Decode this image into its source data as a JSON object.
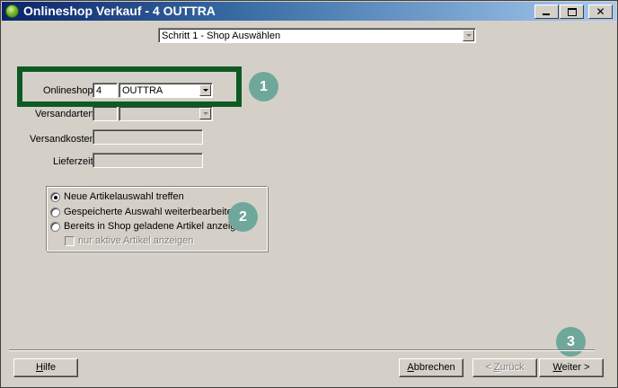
{
  "window": {
    "title": "Onlineshop Verkauf - 4 OUTTRA",
    "controls": {
      "minimize": "_",
      "maximize": "□",
      "close": "✕"
    }
  },
  "step_selector": {
    "value": "Schritt 1 - Shop Auswählen"
  },
  "form": {
    "onlineshop": {
      "label": "Onlineshop",
      "number": "4",
      "name": "OUTTRA"
    },
    "versandarten": {
      "label": "Versandarten",
      "number": "",
      "name": ""
    },
    "versandkosten": {
      "label": "Versandkosten",
      "value": ""
    },
    "lieferzeit": {
      "label": "Lieferzeit",
      "value": ""
    }
  },
  "options": {
    "radios": [
      {
        "label": "Neue Artikelauswahl treffen",
        "checked": true
      },
      {
        "label": "Gespeicherte Auswahl weiterbearbeiten",
        "checked": false
      },
      {
        "label": "Bereits in Shop geladene Artikel anzeigen.",
        "checked": false
      }
    ],
    "checkbox": {
      "label": "nur aktive Artikel anzeigen",
      "checked": false,
      "enabled": false
    }
  },
  "callouts": [
    "1",
    "2",
    "3"
  ],
  "buttons": {
    "help": {
      "accel": "H",
      "rest": "ilfe"
    },
    "cancel": {
      "accel": "A",
      "rest": "bbrechen"
    },
    "back": {
      "prefix": "< ",
      "accel": "Z",
      "rest": "urück"
    },
    "next": {
      "accel": "W",
      "rest": "eiter >"
    }
  },
  "colors": {
    "highlight": "#0e5a24",
    "callout": "#6fa89a",
    "titlebar": "#0a246a",
    "window": "#d4d0c8"
  }
}
